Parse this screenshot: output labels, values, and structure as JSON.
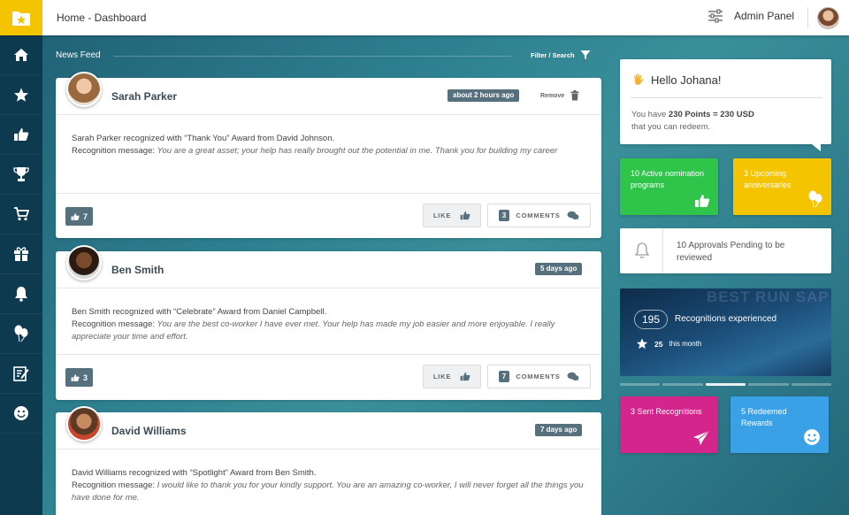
{
  "topbar": {
    "breadcrumb": "Home - Dashboard",
    "admin_label": "Admin Panel"
  },
  "sidebar": {
    "items": [
      "home-icon",
      "star-icon",
      "thumbs-up-icon",
      "trophy-icon",
      "cart-icon",
      "gift-icon",
      "bell-icon",
      "balloons-icon",
      "edit-icon",
      "smiley-icon"
    ]
  },
  "feed": {
    "title": "News Feed",
    "filter_label": "Filter / Search"
  },
  "posts": [
    {
      "name": "Sarah Parker",
      "time": "about 2 hours ago",
      "remove": "Remove",
      "line1": "Sarah Parker recognized with “Thank You” Award from David Johnson.",
      "rm_label": "Recognition message: ",
      "message": "You are a great asset; your help has really brought out the potential in me. Thank you for building my career",
      "likes": "7",
      "like_label": "LIKE",
      "comments": "3",
      "comments_label": "COMMENTS"
    },
    {
      "name": "Ben Smith",
      "time": "5 days ago",
      "line1": "Ben Smith recognized with “Celebrate” Award from Daniel Campbell.",
      "rm_label": "Recognition message: ",
      "message": "You are the best co-worker I have ever met. Your help has made my job easier and more enjoyable. I really appreciate your time and effort.",
      "likes": "3",
      "like_label": "LIKE",
      "comments": "7",
      "comments_label": "COMMENTS"
    },
    {
      "name": "David Williams",
      "time": "7 days ago",
      "line1": "David Williams recognized with “Spotlight” Award from Ben Smith.",
      "rm_label": "Recognition message: ",
      "message": "I would like to thank you for your kindly support. You are an amazing co-worker, I will never forget all the things you have done for me."
    }
  ],
  "hello": {
    "title": "Hello Johana!",
    "line_pre": "You have ",
    "points": "230 Points = 230 USD",
    "line2": "that you can redeem."
  },
  "tiles": {
    "nominations": "10 Active nomination programs",
    "anniversaries": "3 Upcoming anniversaries",
    "approvals": "10 Approvals Pending to be reviewed",
    "sent": "3 Sent Recognitions",
    "redeemed": "5 Redeemed Rewards"
  },
  "slide": {
    "bg_text": "BEST RUN SAP",
    "count": "195",
    "caption": "Recognitions experienced",
    "month_count": "25",
    "month_label": "this month",
    "active_dot": 3
  },
  "colors": {
    "green": "#2ec54a",
    "yellow": "#f5c400",
    "magenta": "#d3258b",
    "blue": "#3aa1e6",
    "slate": "#56707e",
    "sidebar": "#0e3a4f"
  }
}
